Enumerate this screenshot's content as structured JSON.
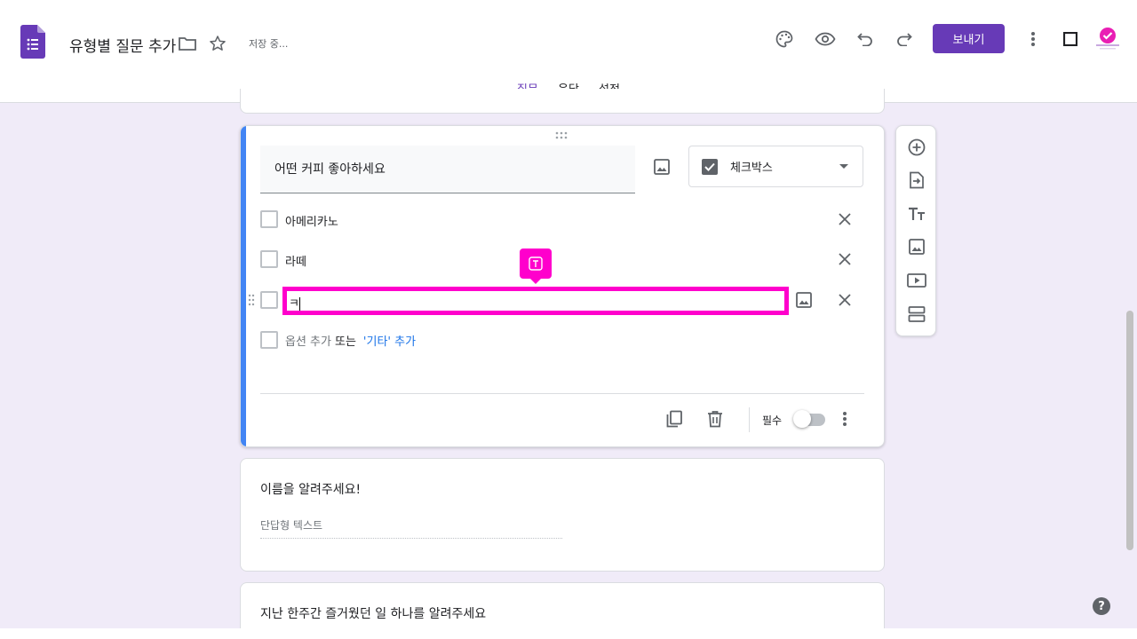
{
  "header": {
    "doc_title": "유형별 질문 추가",
    "saving_status": "저장 중...",
    "send_label": "보내기"
  },
  "tabs": [
    {
      "label": "질문"
    },
    {
      "label": "응답"
    },
    {
      "label": "설정"
    }
  ],
  "question": {
    "title": "어떤 커피 좋아하세요",
    "type_label": "체크박스",
    "options": [
      {
        "label": "아메리카노"
      },
      {
        "label": "라떼"
      }
    ],
    "editing_value": "ㅋ",
    "add_option": "옵션 추가",
    "or_text": "또는",
    "add_other": "'기타' 추가",
    "required_label": "필수"
  },
  "next_question": {
    "title": "이름을 알려주세요!",
    "placeholder": "단답형 텍스트"
  },
  "following_question": {
    "title": "지난 한주간 즐거웠던 일 하나를 알려주세요"
  },
  "help": {
    "label": "?"
  },
  "colors": {
    "accent": "#673ab7",
    "highlight": "#ff00cc",
    "active_bar": "#4285f4",
    "link": "#1a73e8"
  }
}
